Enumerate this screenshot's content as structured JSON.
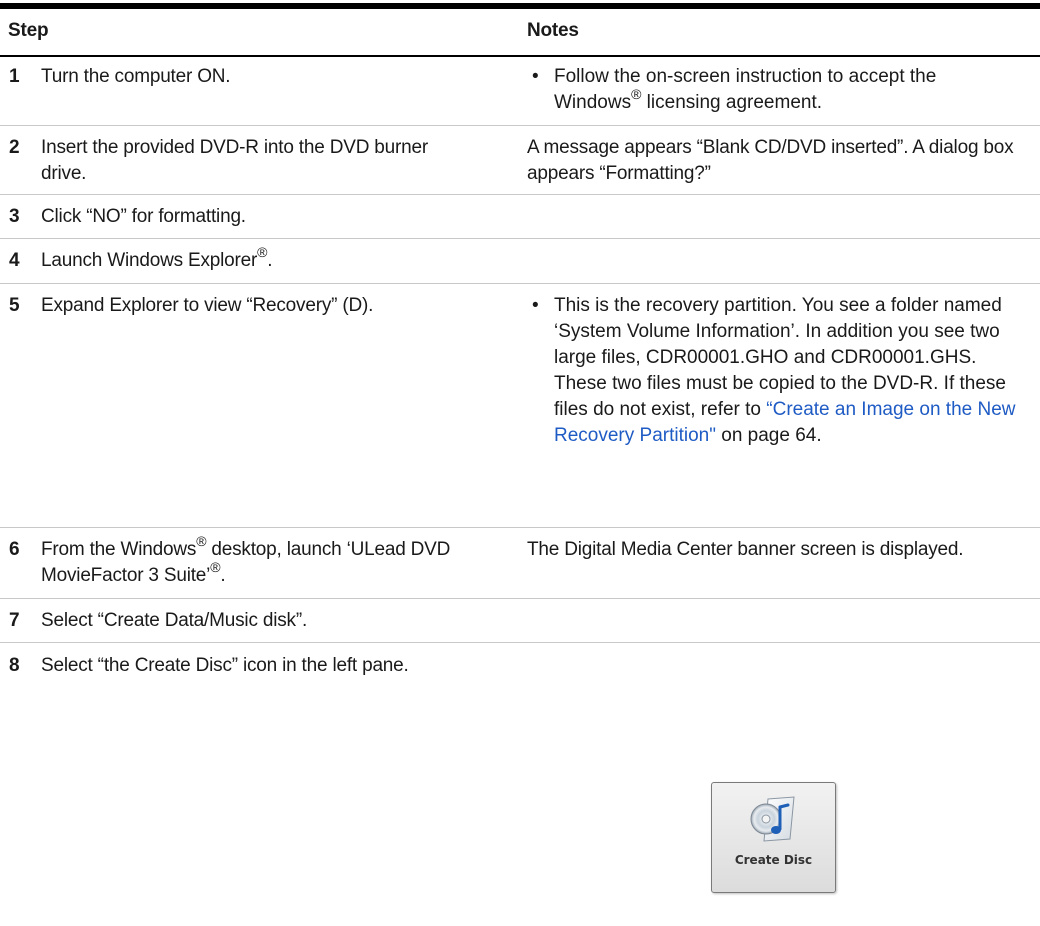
{
  "header": {
    "step": "Step",
    "notes": "Notes"
  },
  "rows": [
    {
      "num": "1",
      "step_parts": [
        "Turn the computer ON."
      ],
      "note_parts": [
        "Follow the on-screen instruction to accept the Windows",
        "®",
        " licensing agreement."
      ]
    },
    {
      "num": "2",
      "step_parts": [
        "Insert the provided DVD-R into the DVD burner drive."
      ],
      "note_parts": [
        "A message appears “Blank CD/DVD inserted”. A dialog box appears “Formatting?”"
      ]
    },
    {
      "num": "3",
      "step_parts": [
        "Click “NO” for formatting."
      ]
    },
    {
      "num": "4",
      "step_parts": [
        "Launch Windows Explorer",
        "®",
        "."
      ]
    },
    {
      "num": "5",
      "step_parts": [
        "Expand Explorer to view “Recovery” (D)."
      ],
      "note_parts": [
        "This is the recovery partition. You see a folder named ‘System Volume Information’. In addition you see two large files, CDR00001.GHO and CDR00001.GHS. These two files must be copied to the DVD-R. If these files do not exist, refer to ",
        "“Create an Image on the New Recovery Partition\"",
        " on page 64."
      ]
    },
    {
      "num": "6",
      "step_parts": [
        "From the Windows",
        "®",
        " desktop, launch ‘ULead DVD MovieFactor 3 Suite’",
        "®",
        "."
      ],
      "note_parts": [
        "The Digital Media Center banner screen is displayed."
      ]
    },
    {
      "num": "7",
      "step_parts": [
        "Select “Create Data/Music disk”."
      ]
    },
    {
      "num": "8",
      "step_parts": [
        "Select “the Create Disc” icon in the left pane."
      ],
      "icon": {
        "name": "create-disc-icon",
        "label": "Create Disc"
      }
    }
  ]
}
